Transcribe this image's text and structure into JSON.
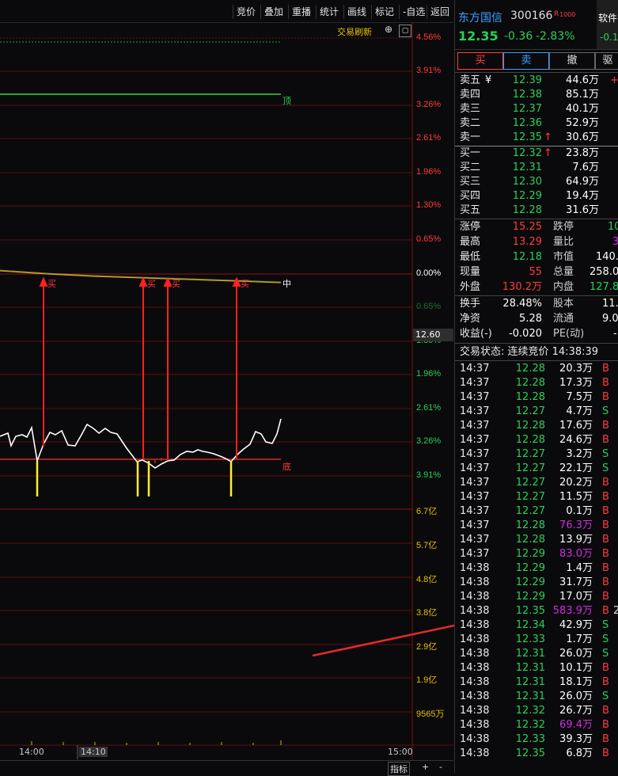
{
  "toolbar": {
    "items": [
      "竞价",
      "叠加",
      "重播",
      "统计",
      "画线",
      "标记",
      "-自选",
      "返回"
    ],
    "trade_refresh": "交易刷新",
    "circle_icon": "⊕"
  },
  "chart": {
    "y_labels": [
      {
        "text": "4.56%",
        "color": "red"
      },
      {
        "text": "3.91%",
        "color": "red"
      },
      {
        "text": "3.26%",
        "color": "red"
      },
      {
        "text": "2.61%",
        "color": "red"
      },
      {
        "text": "1.96%",
        "color": "red"
      },
      {
        "text": "1.30%",
        "color": "red"
      },
      {
        "text": "0.65%",
        "color": "red"
      },
      {
        "text": "0.00%",
        "color": "white"
      },
      {
        "text": "0.65%",
        "color": "green"
      },
      {
        "text": "1.30%",
        "color": "green"
      },
      {
        "text": "1.96%",
        "color": "green"
      },
      {
        "text": "2.61%",
        "color": "green"
      },
      {
        "text": "3.26%",
        "color": "green"
      },
      {
        "text": "3.91%",
        "color": "green"
      }
    ],
    "vol_labels": [
      "6.7亿",
      "5.7亿",
      "4.8亿",
      "3.8亿",
      "2.9亿",
      "1.9亿",
      "9565万"
    ],
    "price_tag": "12.60",
    "ding_label": "顶",
    "zhong_label": "中",
    "di_label": "底",
    "buy_marks": [
      "买",
      "买",
      "买",
      "买"
    ],
    "x_labels": [
      "14:00",
      "14:10",
      "15:00"
    ]
  },
  "bottombar": {
    "indicator": "指标",
    "plus": "+",
    "minus": "-"
  },
  "stock": {
    "name": "东方国信",
    "code": "300166",
    "badge": "R",
    "badge2": "1000",
    "soft_label": "软件",
    "price": "12.35",
    "change": "-0.36",
    "pct": "-2.83%",
    "extra": "-0.1"
  },
  "trade_buttons": [
    "买",
    "卖",
    "撤",
    "驱"
  ],
  "asks": [
    {
      "label": "卖五",
      "price": "12.39",
      "vol": "44.6万",
      "mark": "¥",
      "flag": "+"
    },
    {
      "label": "卖四",
      "price": "12.38",
      "vol": "85.1万",
      "mark": "",
      "flag": ""
    },
    {
      "label": "卖三",
      "price": "12.37",
      "vol": "40.1万",
      "mark": "",
      "flag": ""
    },
    {
      "label": "卖二",
      "price": "12.36",
      "vol": "52.9万",
      "mark": "",
      "flag": ""
    },
    {
      "label": "卖一",
      "price": "12.35",
      "vol": "30.6万",
      "mark": "",
      "flag": "↑"
    }
  ],
  "bids": [
    {
      "label": "买一",
      "price": "12.32",
      "vol": "23.8万",
      "flag": "↑"
    },
    {
      "label": "买二",
      "price": "12.31",
      "vol": "7.6万",
      "flag": ""
    },
    {
      "label": "买三",
      "price": "12.30",
      "vol": "64.9万",
      "flag": ""
    },
    {
      "label": "买四",
      "price": "12.29",
      "vol": "19.4万",
      "flag": ""
    },
    {
      "label": "买五",
      "price": "12.28",
      "vol": "31.6万",
      "flag": ""
    }
  ],
  "stats": [
    {
      "l1": "涨停",
      "v1": "15.25",
      "c1": "red",
      "l2": "跌停",
      "v2": "10",
      "c2": "green"
    },
    {
      "l1": "最高",
      "v1": "13.29",
      "c1": "red",
      "l2": "量比",
      "v2": "3",
      "c2": "purple"
    },
    {
      "l1": "最低",
      "v1": "12.18",
      "c1": "green",
      "l2": "市值",
      "v2": "140.",
      "c2": "white"
    },
    {
      "l1": "现量",
      "v1": "55",
      "c1": "red",
      "l2": "总量",
      "v2": "258.0",
      "c2": "white"
    },
    {
      "l1": "外盘",
      "v1": "130.2万",
      "c1": "red",
      "l2": "内盘",
      "v2": "127.8",
      "c2": "green"
    }
  ],
  "stats2": [
    {
      "l1": "换手",
      "v1": "28.48%",
      "l2": "股本",
      "v2": "11."
    },
    {
      "l1": "净资",
      "v1": "5.28",
      "l2": "流通",
      "v2": "9.0"
    },
    {
      "l1": "收益(-)",
      "v1": "-0.020",
      "l2": "PE(动)",
      "v2": "-"
    }
  ],
  "trade_status": "交易状态: 连续竞价 14:38:39",
  "ticks": [
    {
      "t": "14:37",
      "p": "12.28",
      "v": "20.3万",
      "s": "B",
      "vc": "white"
    },
    {
      "t": "14:37",
      "p": "12.28",
      "v": "17.3万",
      "s": "B",
      "vc": "white"
    },
    {
      "t": "14:37",
      "p": "12.28",
      "v": "7.5万",
      "s": "B",
      "vc": "white"
    },
    {
      "t": "14:37",
      "p": "12.27",
      "v": "4.7万",
      "s": "S",
      "vc": "white"
    },
    {
      "t": "14:37",
      "p": "12.28",
      "v": "17.6万",
      "s": "B",
      "vc": "white"
    },
    {
      "t": "14:37",
      "p": "12.28",
      "v": "24.6万",
      "s": "B",
      "vc": "white"
    },
    {
      "t": "14:37",
      "p": "12.27",
      "v": "3.2万",
      "s": "S",
      "vc": "white"
    },
    {
      "t": "14:37",
      "p": "12.27",
      "v": "22.1万",
      "s": "S",
      "vc": "white"
    },
    {
      "t": "14:37",
      "p": "12.27",
      "v": "20.2万",
      "s": "B",
      "vc": "white"
    },
    {
      "t": "14:37",
      "p": "12.27",
      "v": "11.5万",
      "s": "B",
      "vc": "white"
    },
    {
      "t": "14:37",
      "p": "12.27",
      "v": "0.1万",
      "s": "B",
      "vc": "white"
    },
    {
      "t": "14:37",
      "p": "12.28",
      "v": "76.3万",
      "s": "B",
      "vc": "purple"
    },
    {
      "t": "14:37",
      "p": "12.28",
      "v": "13.9万",
      "s": "B",
      "vc": "white"
    },
    {
      "t": "14:37",
      "p": "12.29",
      "v": "83.0万",
      "s": "B",
      "vc": "purple"
    },
    {
      "t": "14:38",
      "p": "12.29",
      "v": "1.4万",
      "s": "B",
      "vc": "white"
    },
    {
      "t": "14:38",
      "p": "12.29",
      "v": "31.7万",
      "s": "B",
      "vc": "white"
    },
    {
      "t": "14:38",
      "p": "12.29",
      "v": "17.0万",
      "s": "B",
      "vc": "white"
    },
    {
      "t": "14:38",
      "p": "12.35",
      "v": "583.9万",
      "s": "B",
      "vc": "purple",
      "extra": "2"
    },
    {
      "t": "14:38",
      "p": "12.34",
      "v": "42.9万",
      "s": "S",
      "vc": "white"
    },
    {
      "t": "14:38",
      "p": "12.33",
      "v": "1.7万",
      "s": "S",
      "vc": "white"
    },
    {
      "t": "14:38",
      "p": "12.31",
      "v": "26.0万",
      "s": "S",
      "vc": "white"
    },
    {
      "t": "14:38",
      "p": "12.31",
      "v": "10.1万",
      "s": "B",
      "vc": "white"
    },
    {
      "t": "14:38",
      "p": "12.31",
      "v": "18.1万",
      "s": "B",
      "vc": "white"
    },
    {
      "t": "14:38",
      "p": "12.31",
      "v": "26.0万",
      "s": "S",
      "vc": "white"
    },
    {
      "t": "14:38",
      "p": "12.32",
      "v": "26.7万",
      "s": "B",
      "vc": "white"
    },
    {
      "t": "14:38",
      "p": "12.32",
      "v": "69.4万",
      "s": "B",
      "vc": "purple"
    },
    {
      "t": "14:38",
      "p": "12.33",
      "v": "39.3万",
      "s": "B",
      "vc": "white"
    },
    {
      "t": "14:38",
      "p": "12.35",
      "v": "6.8万",
      "s": "B",
      "vc": "white"
    }
  ]
}
